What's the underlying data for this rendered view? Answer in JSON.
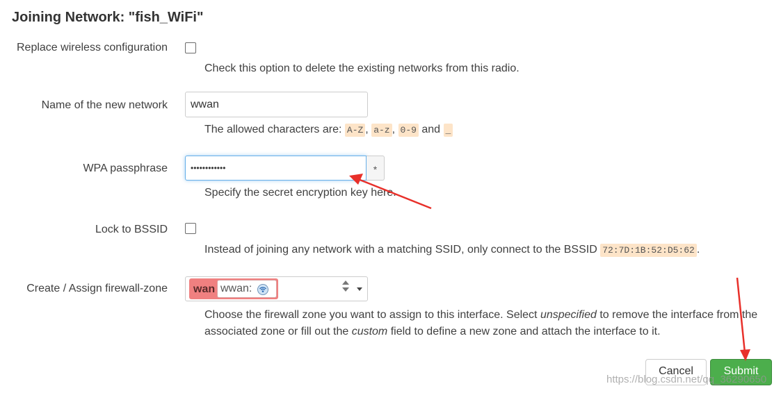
{
  "dialog": {
    "title": "Joining Network: \"fish_WiFi\""
  },
  "replace": {
    "label": "Replace wireless configuration",
    "desc": "Check this option to delete the existing networks from this radio."
  },
  "name": {
    "label": "Name of the new network",
    "value": "wwan",
    "desc_prefix": "The allowed characters are:",
    "codes": [
      "A-Z",
      "a-z",
      "0-9",
      "_"
    ],
    "sep1": ",",
    "sep2": ",",
    "and_word": "and"
  },
  "wpa": {
    "label": "WPA passphrase",
    "value": "••••••••••••",
    "reveal": "*",
    "desc": "Specify the secret encryption key here."
  },
  "bssid": {
    "label": "Lock to BSSID",
    "desc_prefix": "Instead of joining any network with a matching SSID, only connect to the BSSID",
    "code": "72:7D:1B:52:D5:62",
    "desc_suffix": "."
  },
  "firewall": {
    "label": "Create / Assign firewall-zone",
    "zone": "wan",
    "network": "wwan:",
    "network_icon": "wifi-network-icon",
    "desc_1": "Choose the firewall zone you want to assign to this interface. Select",
    "desc_em1": "unspecified",
    "desc_2": "to remove the interface from the associated zone or fill out the",
    "desc_em2": "custom",
    "desc_3": "field to define a new zone and attach the interface to it."
  },
  "buttons": {
    "cancel": "Cancel",
    "submit": "Submit"
  },
  "watermark": "https://blog.csdn.net/qq_36290650",
  "colors": {
    "submit": "#4cae4c",
    "zone_wan": "#f08080",
    "code_bg": "#fde4c8",
    "annotation_arrow": "#e8302a"
  }
}
